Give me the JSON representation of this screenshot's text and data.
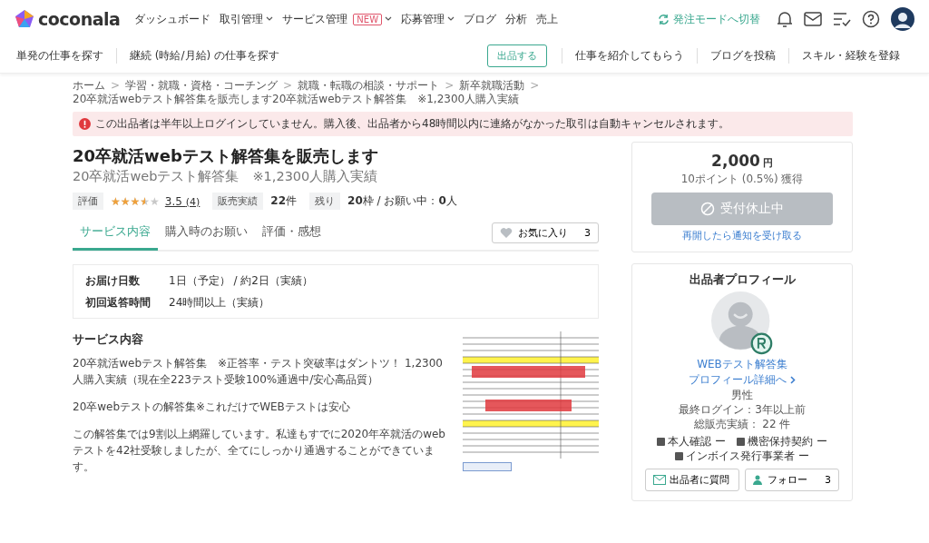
{
  "header": {
    "logo": "coconala",
    "nav": [
      {
        "label": "ダッシュボード",
        "dropdown": false
      },
      {
        "label": "取引管理",
        "dropdown": true
      },
      {
        "label": "サービス管理",
        "dropdown": true,
        "badge": "NEW"
      },
      {
        "label": "応募管理",
        "dropdown": true
      },
      {
        "label": "ブログ",
        "dropdown": false
      },
      {
        "label": "分析",
        "dropdown": false
      },
      {
        "label": "売上",
        "dropdown": false
      }
    ],
    "switch_mode": "発注モードへ切替"
  },
  "subnav": {
    "left": [
      "単発の仕事を探す",
      "継続 (時給/月給) の仕事を探す"
    ],
    "post_button": "出品する",
    "right": [
      "仕事を紹介してもらう",
      "ブログを投稿",
      "スキル・経験を登録"
    ]
  },
  "breadcrumb_separator": ">",
  "breadcrumbs": [
    "ホーム",
    "学習・就職・資格・コーチング",
    "就職・転職の相談・サポート",
    "新卒就職活動",
    "20卒就活webテスト解答集を販売します20卒就活webテスト解答集　※1,2300人購入実績"
  ],
  "alert": "この出品者は半年以上ログインしていません。購入後、出品者から48時間以内に連絡がなかった取引は自動キャンセルされます。",
  "title": "20卒就活webテスト解答集を販売します",
  "subtitle": "20卒就活webテスト解答集　※1,2300人購入実績",
  "stats": {
    "rating_label": "評価",
    "stars": 3.5,
    "score": "3.5",
    "review_count": "(4)",
    "sales_label": "販売実績",
    "sales": "**22**件",
    "remaining_label": "残り",
    "remaining": "**20**枠 / お願い中：**0**人"
  },
  "tabs": [
    {
      "label": "サービス内容",
      "selected": true
    },
    {
      "label": "購入時のお願い",
      "selected": false
    },
    {
      "label": "評価・感想",
      "selected": false
    }
  ],
  "favorite": {
    "label": "お気に入り",
    "count": "3"
  },
  "delivery": [
    {
      "label": "お届け日数",
      "value": "1日（予定） / 約2日（実績）"
    },
    {
      "label": "初回返答時間",
      "value": "24時間以上（実績）"
    }
  ],
  "section_title": "サービス内容",
  "paragraphs": [
    "20卒就活webテスト解答集　※正答率・テスト突破率はダントツ！ 1,2300人購入実績（現在全223テスト受験100%通過中/安心高品質）",
    "20卒webテストの解答集※これだけでWEBテストは安心",
    "この解答集では9割以上網羅しています。私達もすでに2020年卒就活のwebテストを42社受験しましたが、全てにしっかり通過することができています。"
  ],
  "price_card": {
    "price": "2,000",
    "currency": "円",
    "points": "10ポイント (0.5%) 獲得",
    "order_button": {
      "label": "受付休止中",
      "disabled": true
    },
    "notify_link": "再開したら通知を受け取る"
  },
  "profile": {
    "title": "出品者プロフィール",
    "name": "WEBテスト解答集",
    "detail_link": "プロフィール詳細へ",
    "gender": "男性",
    "last_login": "最終ログイン：3年以上前",
    "total_sales": "総販売実績： 22 件",
    "badges": [
      "本人確認 ー",
      "機密保持契約 ー",
      "インボイス発行事業者 ー"
    ],
    "question_button": "出品者に質問",
    "follow_button": "フォロー",
    "follow_count": "3"
  }
}
